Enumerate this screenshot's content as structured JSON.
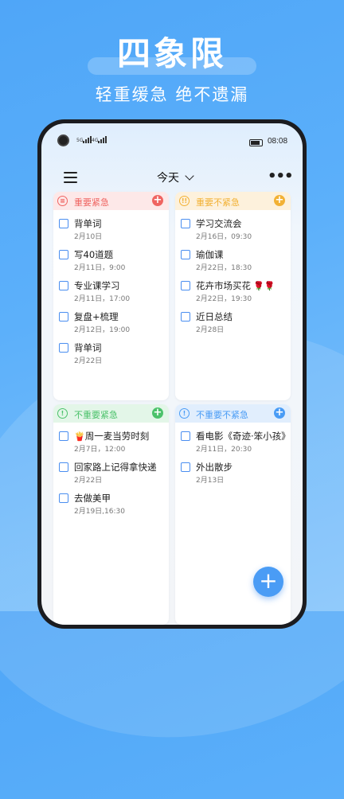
{
  "hero": {
    "title": "四象限",
    "subtitle": "轻重缓急 绝不遗漏"
  },
  "status_bar": {
    "time": "08:08",
    "sig1": "5G",
    "sig2": "4G"
  },
  "toolbar": {
    "title": "今天"
  },
  "quadrants": [
    {
      "label": "重要紧急",
      "color": "#ef6461",
      "bg": "#fde8e8",
      "tasks": [
        {
          "name": "背单词",
          "date": "2月10日"
        },
        {
          "name": "写40道题",
          "date": "2月11日，9:00"
        },
        {
          "name": "专业课学习",
          "date": "2月11日，17:00"
        },
        {
          "name": "复盘+梳理",
          "date": "2月12日，19:00"
        },
        {
          "name": "背单词",
          "date": "2月22日"
        }
      ]
    },
    {
      "label": "重要不紧急",
      "color": "#f2b134",
      "bg": "#fdf1dc",
      "tasks": [
        {
          "name": "学习交流会",
          "date": "2月16日，09:30"
        },
        {
          "name": "瑜伽课",
          "date": "2月22日，18:30"
        },
        {
          "name": "花卉市场买花",
          "emoji": "🌹🌹",
          "date": "2月22日，19:30"
        },
        {
          "name": "近日总结",
          "date": "2月28日"
        }
      ]
    },
    {
      "label": "不重要紧急",
      "color": "#4cc26b",
      "bg": "#e3f6e8",
      "tasks": [
        {
          "name": "周一麦当劳时刻",
          "emoji": "🍟",
          "date": "2月7日，12:00"
        },
        {
          "name": "回家路上记得拿快递",
          "date": "2月22日"
        },
        {
          "name": "去做美甲",
          "date": "2月19日,16:30"
        }
      ]
    },
    {
      "label": "不重要不紧急",
      "color": "#4a9cf5",
      "bg": "#e1eefd",
      "tasks": [
        {
          "name": "看电影《奇迹·笨小孩》",
          "date": "2月11日，20:30"
        },
        {
          "name": "外出散步",
          "date": "2月13日"
        }
      ]
    }
  ],
  "icons": {
    "q1": "calendar-icon",
    "q2": "double-exclaim-icon",
    "q3": "exclaim-icon",
    "q4": "exclaim-icon",
    "menu": "menu-icon",
    "more": "more-icon",
    "add": "plus-icon"
  }
}
